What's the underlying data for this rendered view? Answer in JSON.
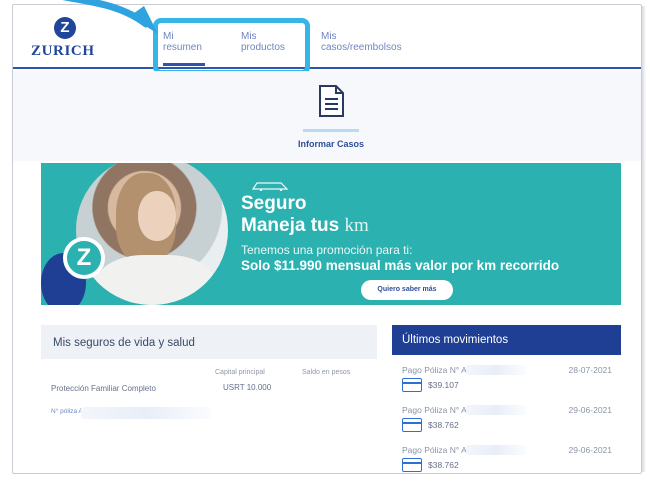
{
  "brand": {
    "logo_mark": "Z",
    "logo_text": "ZURICH"
  },
  "nav": {
    "tabs": [
      {
        "line1": "Mi",
        "line2": "resumen",
        "active": true
      },
      {
        "line1": "Mis",
        "line2": "productos",
        "active": false
      },
      {
        "line1": "Mis",
        "line2": "casos/reembolsos",
        "active": false
      }
    ]
  },
  "report": {
    "label": "Informar Casos",
    "icon": "document-icon"
  },
  "banner": {
    "title": "Seguro",
    "subtitle_bold": "Maneja tus",
    "subtitle_light": "km",
    "line1": "Tenemos una promoción para ti:",
    "line2": "Solo $11.990 mensual más valor por km recorrido",
    "button": "Quiero saber más",
    "logo_mark": "Z"
  },
  "life_insurance": {
    "title": "Mis seguros de vida y salud",
    "columns": [
      "Capital principal",
      "Saldo en pesos"
    ],
    "item": {
      "name": "Protección Familiar Completo",
      "capital": "USRT 10.000",
      "poliza_label": "N° póliza A-"
    }
  },
  "movements": {
    "title": "Últimos movimientos",
    "items": [
      {
        "label": "Pago Póliza N° A-",
        "date": "28-07-2021",
        "amount": "$39.107"
      },
      {
        "label": "Pago Póliza N° A-",
        "date": "29-06-2021",
        "amount": "$38.762"
      },
      {
        "label": "Pago Póliza N° A-",
        "date": "29-06-2021",
        "amount": "$38.762"
      }
    ]
  },
  "colors": {
    "brand_blue": "#21459b",
    "accent_teal": "#2bb1b0",
    "highlight": "#36b6e6",
    "nav_dark": "#1f3f94"
  }
}
